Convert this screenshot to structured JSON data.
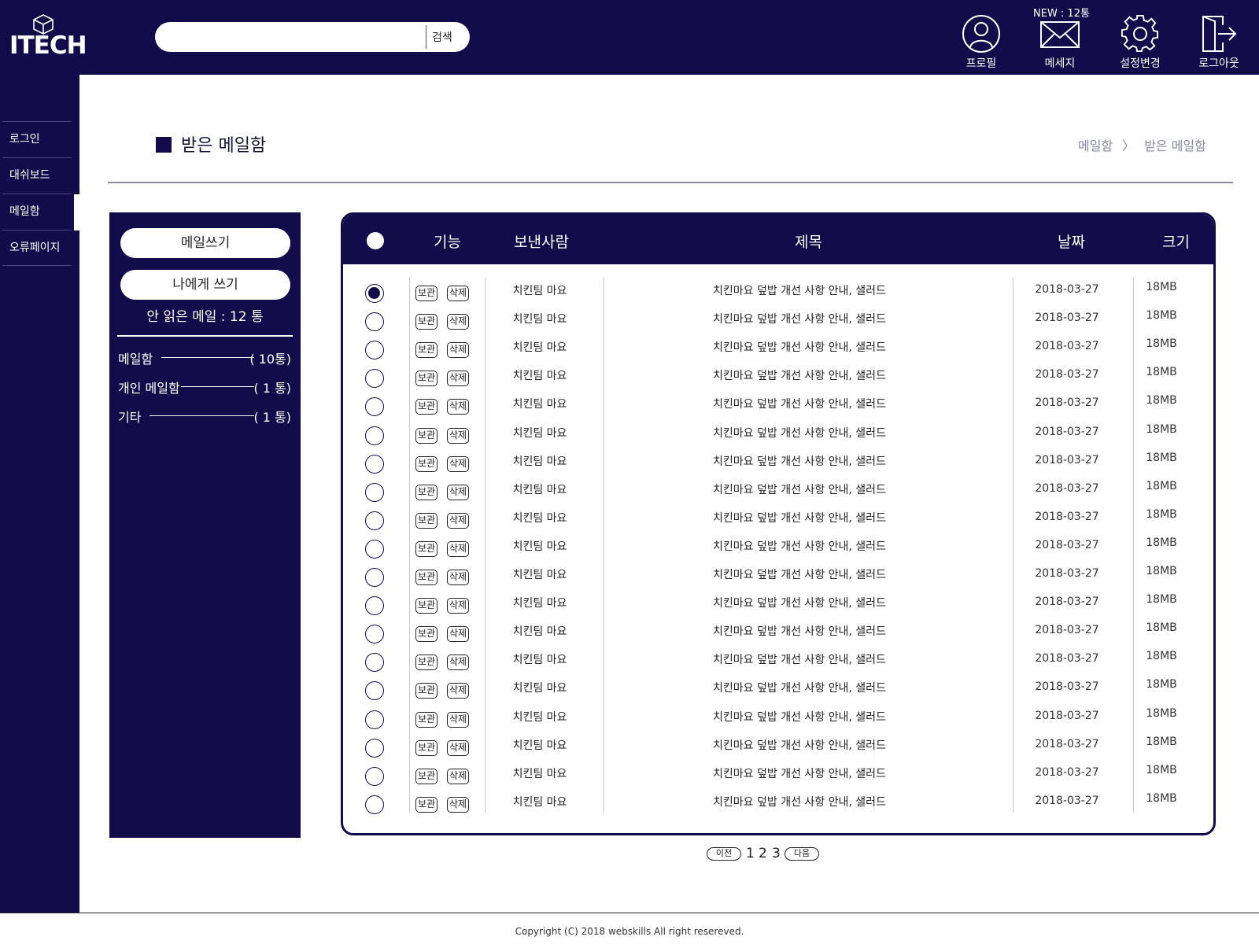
{
  "brand": {
    "name": "ITECH"
  },
  "header": {
    "search_placeholder": "",
    "search_button": "검색",
    "new_count": "NEW : 12통",
    "icons": [
      {
        "name": "profile-icon",
        "label": "프로필"
      },
      {
        "name": "message-icon",
        "label": "메세지"
      },
      {
        "name": "settings-icon",
        "label": "설정변경"
      },
      {
        "name": "logout-icon",
        "label": "로그아웃"
      }
    ]
  },
  "sidebar": {
    "items": [
      {
        "label": "로그인",
        "active": false
      },
      {
        "label": "대쉬보드",
        "active": false
      },
      {
        "label": "메일함",
        "active": true
      },
      {
        "label": "오류페이지",
        "active": false
      }
    ]
  },
  "page": {
    "title": "받은 메일함",
    "breadcrumb": [
      "메일함",
      "받은 메일함"
    ],
    "breadcrumb_sep": "〉"
  },
  "mail_panel": {
    "compose_button": "메일쓰기",
    "self_compose_button": "나에게 쓰기",
    "unread_text": "안 읽은 메일   :  12 통",
    "folders": [
      {
        "name": "메일함",
        "count": "( 10통)"
      },
      {
        "name": "개인 메일함",
        "count": "( 1 통)"
      },
      {
        "name": "기타",
        "count": "( 1 통)"
      }
    ]
  },
  "mail_table": {
    "columns": {
      "function": "기능",
      "sender": "보낸사람",
      "subject": "제목",
      "date": "날짜",
      "size": "크기"
    },
    "keep_label": "보관",
    "delete_label": "삭제",
    "rows": [
      {
        "selected": true,
        "sender": "치킨팀 마요",
        "subject": "치킨마요 덮밥 개선 사항 안내, 샐러드",
        "date": "2018-03-27",
        "size": "18MB"
      },
      {
        "selected": false,
        "sender": "치킨팀 마요",
        "subject": "치킨마요 덮밥 개선 사항 안내, 샐러드",
        "date": "2018-03-27",
        "size": "18MB"
      },
      {
        "selected": false,
        "sender": "치킨팀 마요",
        "subject": "치킨마요 덮밥 개선 사항 안내, 샐러드",
        "date": "2018-03-27",
        "size": "18MB"
      },
      {
        "selected": false,
        "sender": "치킨팀 마요",
        "subject": "치킨마요 덮밥 개선 사항 안내, 샐러드",
        "date": "2018-03-27",
        "size": "18MB"
      },
      {
        "selected": false,
        "sender": "치킨팀 마요",
        "subject": "치킨마요 덮밥 개선 사항 안내, 샐러드",
        "date": "2018-03-27",
        "size": "18MB"
      },
      {
        "selected": false,
        "sender": "치킨팀 마요",
        "subject": "치킨마요 덮밥 개선 사항 안내, 샐러드",
        "date": "2018-03-27",
        "size": "18MB"
      },
      {
        "selected": false,
        "sender": "치킨팀 마요",
        "subject": "치킨마요 덮밥 개선 사항 안내, 샐러드",
        "date": "2018-03-27",
        "size": "18MB"
      },
      {
        "selected": false,
        "sender": "치킨팀 마요",
        "subject": "치킨마요 덮밥 개선 사항 안내, 샐러드",
        "date": "2018-03-27",
        "size": "18MB"
      },
      {
        "selected": false,
        "sender": "치킨팀 마요",
        "subject": "치킨마요 덮밥 개선 사항 안내, 샐러드",
        "date": "2018-03-27",
        "size": "18MB"
      },
      {
        "selected": false,
        "sender": "치킨팀 마요",
        "subject": "치킨마요 덮밥 개선 사항 안내, 샐러드",
        "date": "2018-03-27",
        "size": "18MB"
      },
      {
        "selected": false,
        "sender": "치킨팀 마요",
        "subject": "치킨마요 덮밥 개선 사항 안내, 샐러드",
        "date": "2018-03-27",
        "size": "18MB"
      },
      {
        "selected": false,
        "sender": "치킨팀 마요",
        "subject": "치킨마요 덮밥 개선 사항 안내, 샐러드",
        "date": "2018-03-27",
        "size": "18MB"
      },
      {
        "selected": false,
        "sender": "치킨팀 마요",
        "subject": "치킨마요 덮밥 개선 사항 안내, 샐러드",
        "date": "2018-03-27",
        "size": "18MB"
      },
      {
        "selected": false,
        "sender": "치킨팀 마요",
        "subject": "치킨마요 덮밥 개선 사항 안내, 샐러드",
        "date": "2018-03-27",
        "size": "18MB"
      },
      {
        "selected": false,
        "sender": "치킨팀 마요",
        "subject": "치킨마요 덮밥 개선 사항 안내, 샐러드",
        "date": "2018-03-27",
        "size": "18MB"
      },
      {
        "selected": false,
        "sender": "치킨팀 마요",
        "subject": "치킨마요 덮밥 개선 사항 안내, 샐러드",
        "date": "2018-03-27",
        "size": "18MB"
      },
      {
        "selected": false,
        "sender": "치킨팀 마요",
        "subject": "치킨마요 덮밥 개선 사항 안내, 샐러드",
        "date": "2018-03-27",
        "size": "18MB"
      },
      {
        "selected": false,
        "sender": "치킨팀 마요",
        "subject": "치킨마요 덮밥 개선 사항 안내, 샐러드",
        "date": "2018-03-27",
        "size": "18MB"
      },
      {
        "selected": false,
        "sender": "치킨팀 마요",
        "subject": "치킨마요 덮밥 개선 사항 안내, 샐러드",
        "date": "2018-03-27",
        "size": "18MB"
      }
    ]
  },
  "pagination": {
    "prev": "이전",
    "pages": [
      "1",
      "2",
      "3"
    ],
    "next": "다음"
  },
  "footer": {
    "copyright": "Copyright (C) 2018 webskills All right resereved."
  },
  "colors": {
    "primary": "#120c4a",
    "background": "#ffffff",
    "divider": "#8d8aa8"
  }
}
